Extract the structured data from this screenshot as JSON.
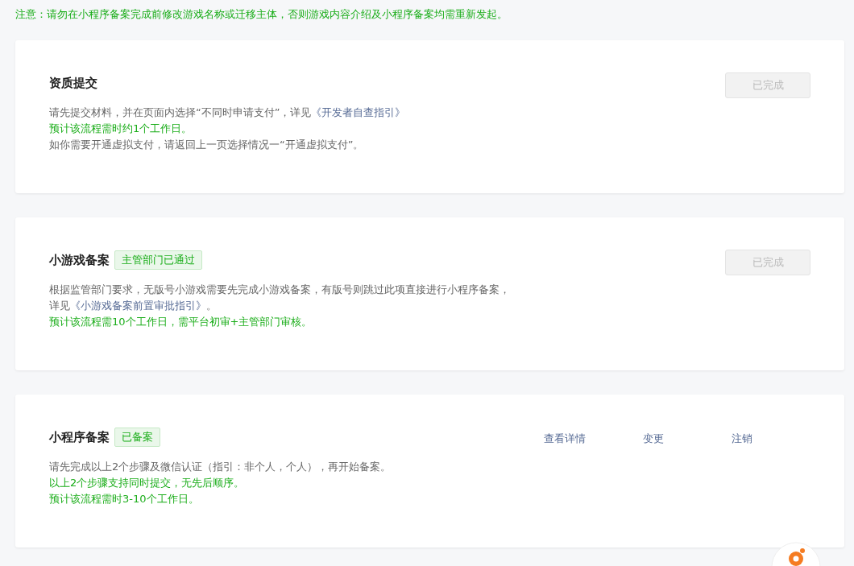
{
  "notice": "注意：请勿在小程序备案完成前修改游戏名称或迁移主体，否则游戏内容介绍及小程序备案均需重新发起。",
  "sections": [
    {
      "title": "资质提交",
      "action": {
        "label": "已完成",
        "disabled": true
      },
      "lines": [
        {
          "kind": "gray",
          "parts": [
            {
              "text": "请先提交材料，并在页面内选择“不同时申请支付”，详见",
              "link": false
            },
            {
              "text": "《开发者自查指引》",
              "link": true
            }
          ]
        },
        {
          "kind": "green",
          "parts": [
            {
              "text": "预计该流程需时约1个工作日。",
              "link": false
            }
          ]
        },
        {
          "kind": "gray",
          "parts": [
            {
              "text": "如你需要开通虚拟支付，请返回上一页选择情况一“开通虚拟支付”。",
              "link": false
            }
          ]
        }
      ]
    },
    {
      "title": "小游戏备案",
      "tag": "主管部门已通过",
      "action": {
        "label": "已完成",
        "disabled": true
      },
      "lines": [
        {
          "kind": "gray",
          "parts": [
            {
              "text": "根据监管部门要求，无版号小游戏需要先完成小游戏备案，有版号则跳过此项直接进行小程序备案，",
              "link": false
            }
          ]
        },
        {
          "kind": "gray",
          "parts": [
            {
              "text": "详见",
              "link": false
            },
            {
              "text": "《小游戏备案前置审批指引》",
              "link": true
            },
            {
              "text": "。",
              "link": false
            }
          ]
        },
        {
          "kind": "green",
          "parts": [
            {
              "text": "预计该流程需10个工作日，需平台初审+主管部门审核。",
              "link": false
            }
          ]
        }
      ]
    },
    {
      "title": "小程序备案",
      "tag": "已备案",
      "links": [
        "查看详情",
        "变更",
        "注销"
      ],
      "lines": [
        {
          "kind": "gray",
          "parts": [
            {
              "text": "请先完成以上2个步骤及微信认证（指引：非个人，个人），再开始备案。",
              "link": false
            }
          ]
        },
        {
          "kind": "green",
          "parts": [
            {
              "text": "以上2个步骤支持同时提交，无先后顺序。",
              "link": false
            }
          ]
        },
        {
          "kind": "green",
          "parts": [
            {
              "text": "预计该流程需时3-10个工作日。",
              "link": false
            }
          ]
        }
      ]
    }
  ]
}
